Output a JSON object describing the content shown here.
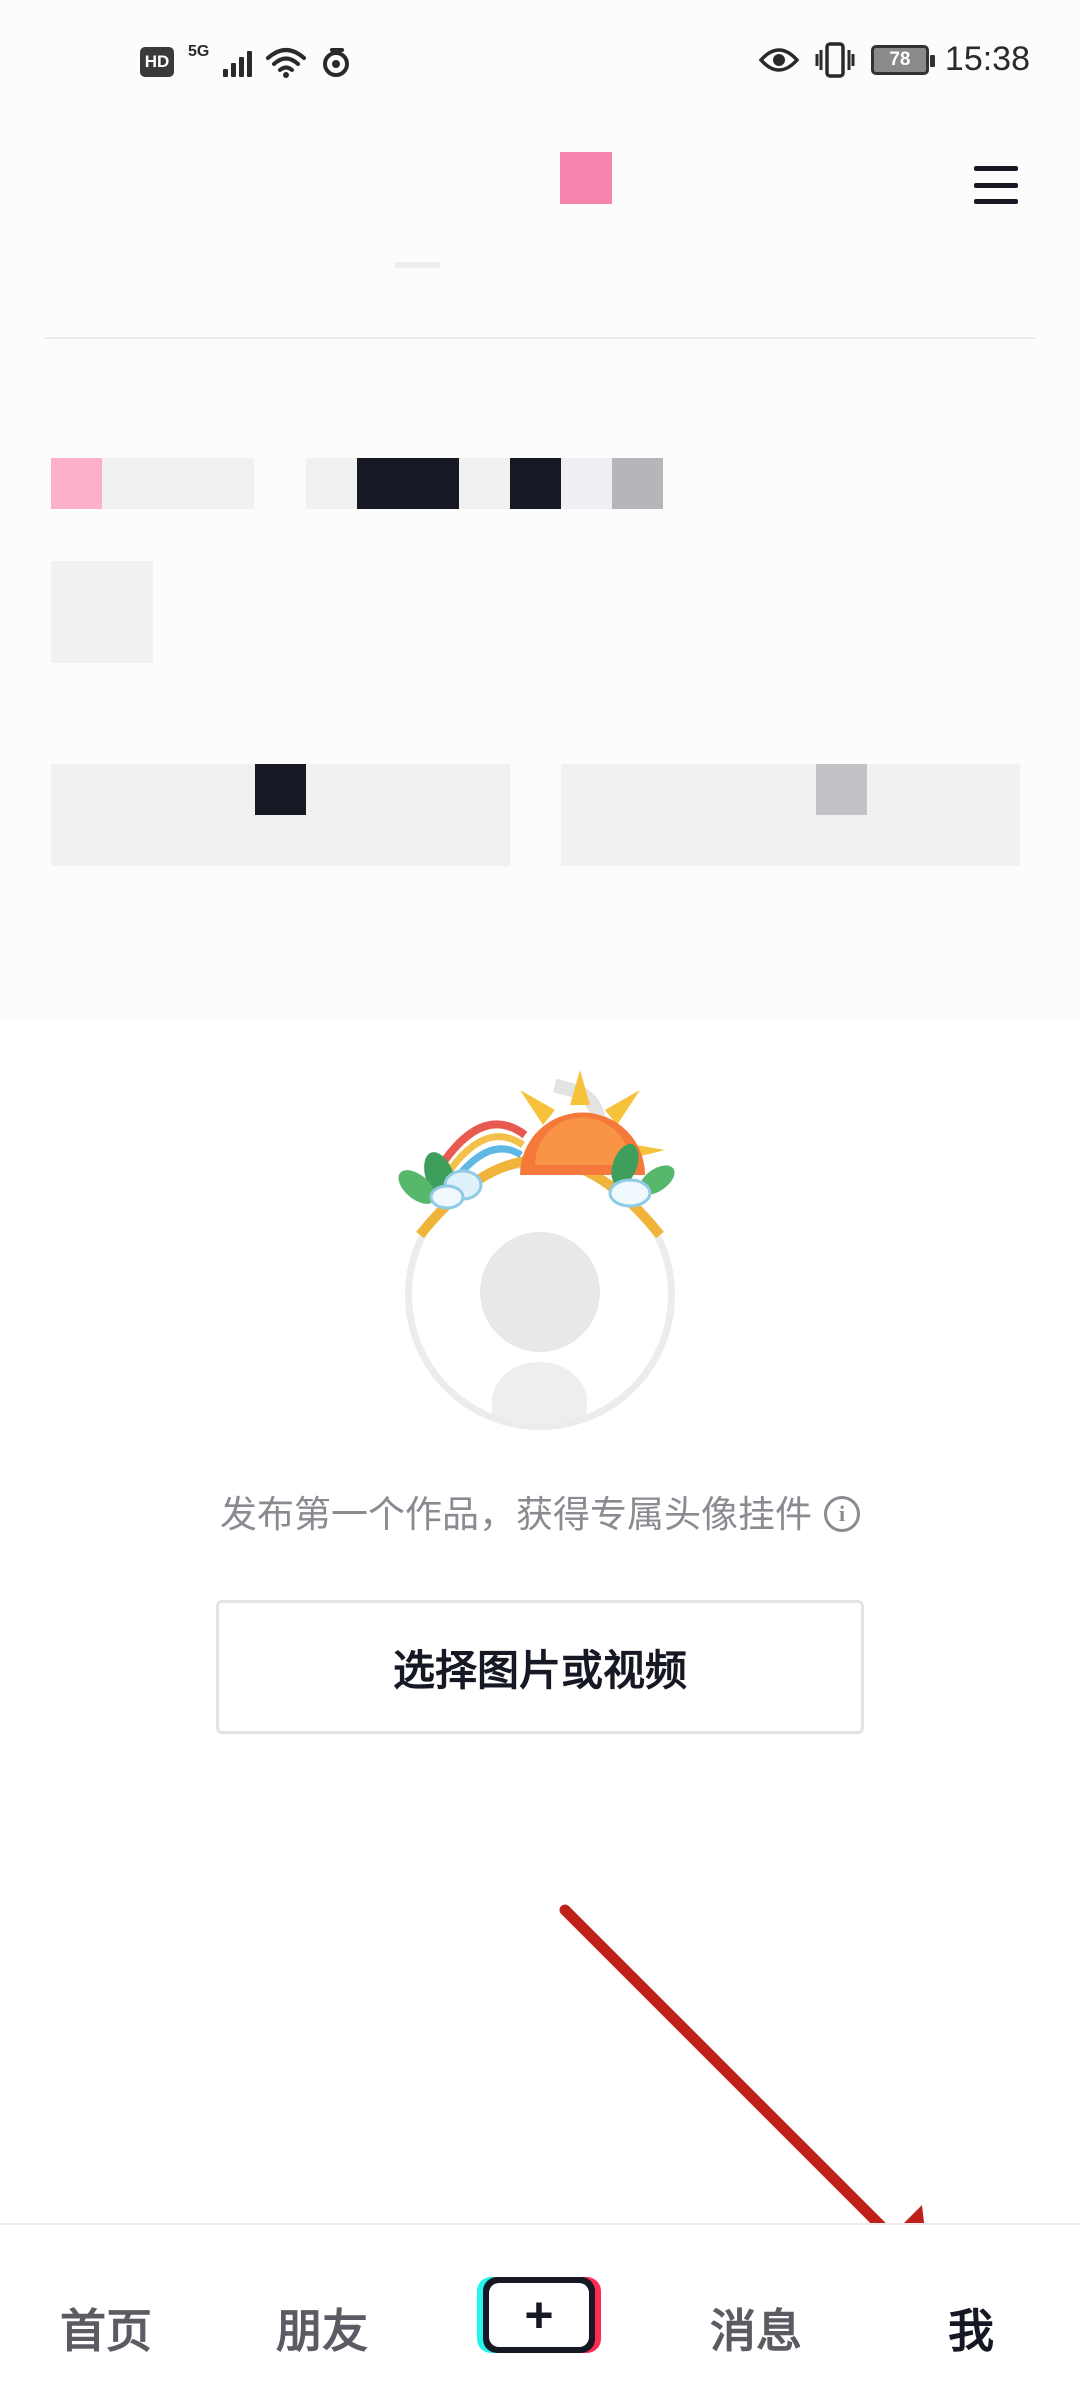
{
  "status_bar": {
    "hd": "HD",
    "network": "5G",
    "battery": "78",
    "time": "15:38",
    "icons": [
      "hd-icon",
      "signal-icon",
      "wifi-icon",
      "hotspot-icon",
      "eye-icon",
      "vibrate-icon",
      "battery-icon"
    ]
  },
  "header": {
    "menu_icon": "hamburger-menu-icon"
  },
  "empty_state": {
    "hint": "发布第一个作品，获得专属头像挂件",
    "hint_icon": "info-icon",
    "select_button": "选择图片或视频"
  },
  "tab_bar": {
    "home": "首页",
    "friends": "朋友",
    "create": "+",
    "messages": "消息",
    "me": "我"
  },
  "colors": {
    "accent_pink": "#f584ae",
    "arrow_red": "#c0201a",
    "text_dark": "#161823",
    "text_muted": "#8a8b91"
  }
}
